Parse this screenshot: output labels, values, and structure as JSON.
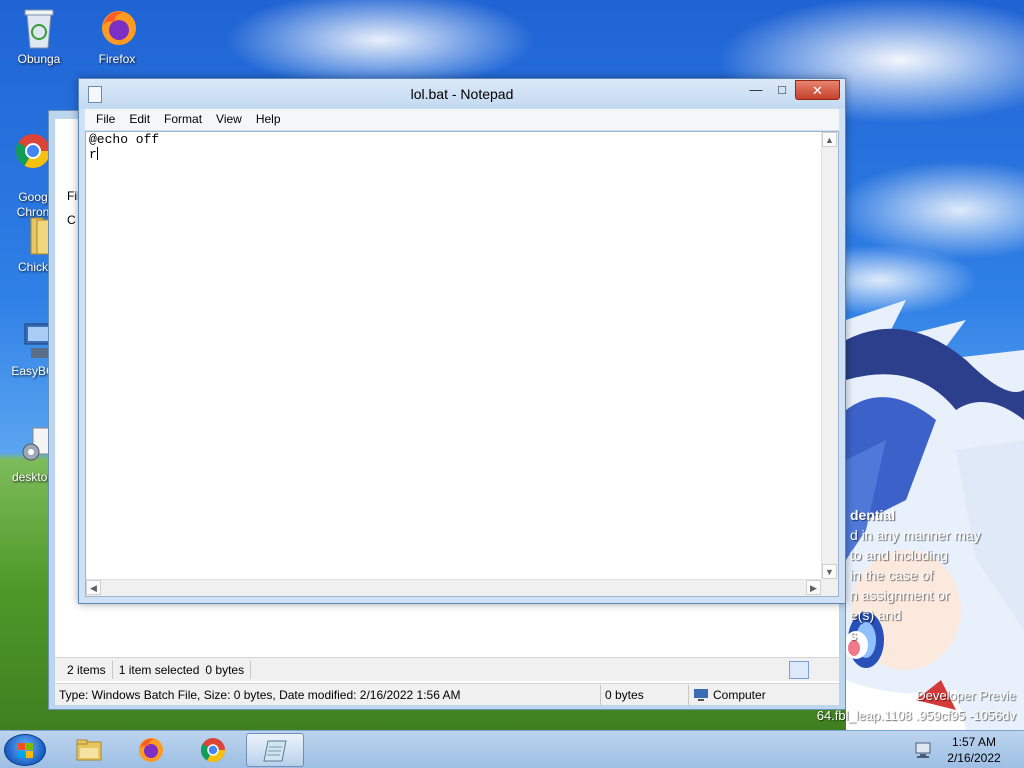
{
  "desktop": {
    "icons": [
      {
        "label": "Obunga"
      },
      {
        "label": "Firefox"
      },
      {
        "label": "Goog\nChron"
      },
      {
        "label": "Chick"
      },
      {
        "label": "EasyBC"
      },
      {
        "label": "desktop"
      }
    ]
  },
  "wallpaper": {
    "lines": [
      "dential",
      "d in any manner may",
      "to and including",
      "in the case of",
      "n assignment or",
      "e(s) and",
      "s"
    ],
    "build_line1": "Developer Previe",
    "build_line2": "64.fbl_leap.1108 .959cf95 -1056dv"
  },
  "explorer": {
    "partial_labels": [
      "Fil",
      "C"
    ],
    "items_count": "2 items",
    "selected": "1 item selected",
    "selected_size": "0 bytes",
    "details": "Type: Windows Batch File, Size: 0 bytes, Date modified: 2/16/2022 1:56 AM",
    "size": "0 bytes",
    "location": "Computer"
  },
  "notepad": {
    "title": "lol.bat - Notepad",
    "buttons": {
      "minimize": "—",
      "maximize": "□",
      "close": "✕"
    },
    "menu": [
      "File",
      "Edit",
      "Format",
      "View",
      "Help"
    ],
    "content_line1": "@echo off",
    "content_line2": "r"
  },
  "taskbar": {
    "time": "1:57 AM",
    "date": "2/16/2022",
    "apps": [
      {
        "name": "File Explorer",
        "icon": "folder-icon"
      },
      {
        "name": "Firefox",
        "icon": "firefox-icon"
      },
      {
        "name": "Google Chrome",
        "icon": "chrome-icon"
      },
      {
        "name": "Notepad",
        "icon": "notepad-icon",
        "active": true
      }
    ]
  },
  "colors": {
    "titlebar": "#c3d9f1",
    "close_button": "#c7412b",
    "taskbar": "#9dbfe4"
  }
}
